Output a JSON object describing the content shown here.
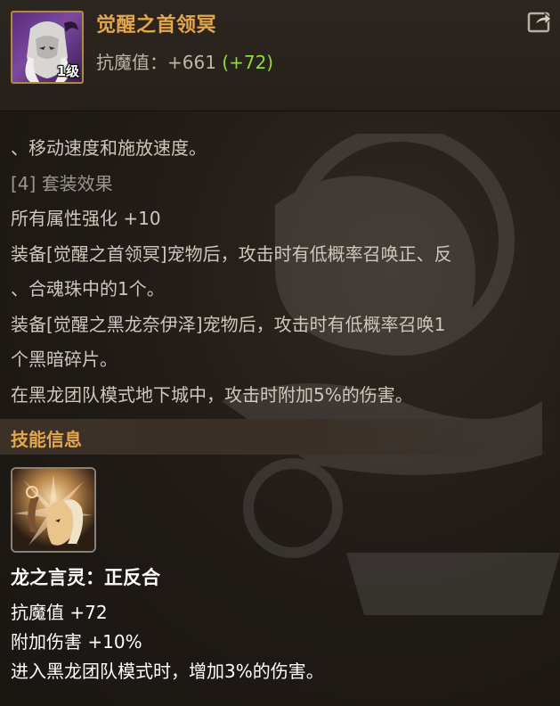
{
  "item": {
    "name": "觉醒之首领冥",
    "level_badge": "1级",
    "stat_label": "抗魔值：",
    "stat_value": "+661",
    "stat_bonus": "(+72)",
    "icon_name": "pet-avatar-icon"
  },
  "header": {
    "share_icon": "share-icon"
  },
  "description": {
    "lines": [
      "、移动速度和施放速度。",
      "[4] 套装效果",
      "所有属性强化 +10",
      "装备[觉醒之首领冥]宠物后，攻击时有低概率召唤正、反",
      "、合魂珠中的1个。",
      "装备[觉醒之黑龙奈伊泽]宠物后，攻击时有低概率召唤1",
      "个黑暗碎片。",
      "在黑龙团队模式地下城中，攻击时附加5%的伤害。"
    ]
  },
  "skill_section": {
    "title": "技能信息",
    "skill_name": "龙之言灵：正反合",
    "stats": [
      "抗魔值 +72",
      "附加伤害 +10%",
      "进入黑龙团队模式时，增加3%的伤害。"
    ],
    "icon_name": "skill-icon"
  },
  "colors": {
    "title_gold": "#e4a64a",
    "bonus_green": "#8edc3c",
    "text": "#cfc7ba",
    "background": "#1e1915"
  }
}
